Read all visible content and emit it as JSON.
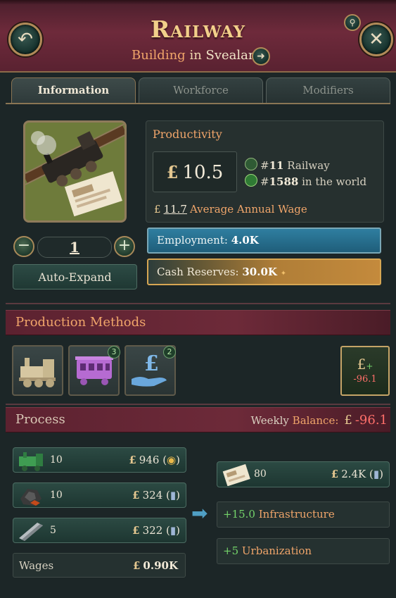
{
  "header": {
    "title": "Railway",
    "subtitle_keyword": "Building",
    "subtitle_in": "in",
    "subtitle_location": "Svealand"
  },
  "tabs": [
    "Information",
    "Workforce",
    "Modifiers"
  ],
  "building": {
    "level": "1",
    "auto_expand_label": "Auto-Expand"
  },
  "productivity": {
    "label": "Productivity",
    "currency": "£",
    "value": "10.5",
    "rank_railway_prefix": "#",
    "rank_railway": "11",
    "rank_railway_label": "Railway",
    "rank_world_prefix": "#",
    "rank_world": "1588",
    "rank_world_label": "in the world",
    "wage_value": "11.7",
    "wage_label": "Average Annual Wage"
  },
  "employment": {
    "label": "Employment:",
    "value": "4.0K",
    "fill_fraction": 1.0
  },
  "cash_reserves": {
    "label": "Cash Reserves:",
    "value": "30.0K",
    "fill_fraction": 1.0
  },
  "production_methods": {
    "title": "Production Methods",
    "methods": [
      {
        "icon": "steam-locomotive-icon",
        "badge": ""
      },
      {
        "icon": "passenger-carriage-icon",
        "badge": "3"
      },
      {
        "icon": "pound-hand-icon",
        "badge": "2"
      }
    ],
    "balance_value": "-96.1"
  },
  "process": {
    "title": "Process",
    "weekly_label_1": "Weekly",
    "weekly_label_2": "Balance:",
    "weekly_value": "-96.1",
    "inputs": [
      {
        "icon": "engines-icon",
        "qty": "10",
        "price": "946",
        "trend_icon": "coins-stack-icon"
      },
      {
        "icon": "coal-icon",
        "qty": "10",
        "price": "324",
        "trend_icon": "coins-small-icon"
      },
      {
        "icon": "steel-icon",
        "qty": "5",
        "price": "322",
        "trend_icon": "coins-small-icon"
      }
    ],
    "wages_label": "Wages",
    "wages_value": "0.90K",
    "outputs": [
      {
        "icon": "transportation-ticket-icon",
        "qty": "80",
        "price": "2.4K",
        "trend_icon": "coins-small-icon"
      }
    ],
    "infrastructure_value": "+15.0",
    "infrastructure_label": "Infrastructure",
    "urbanization_value": "+5",
    "urbanization_label": "Urbanization"
  },
  "colors": {
    "header_bg": "#6e2a3b",
    "accent_orange": "#f0a56a",
    "employment_bar": "#2f7ea0",
    "cash_bar": "#c48a3c",
    "negative": "#ff6f6a",
    "positive": "#74d36a"
  }
}
